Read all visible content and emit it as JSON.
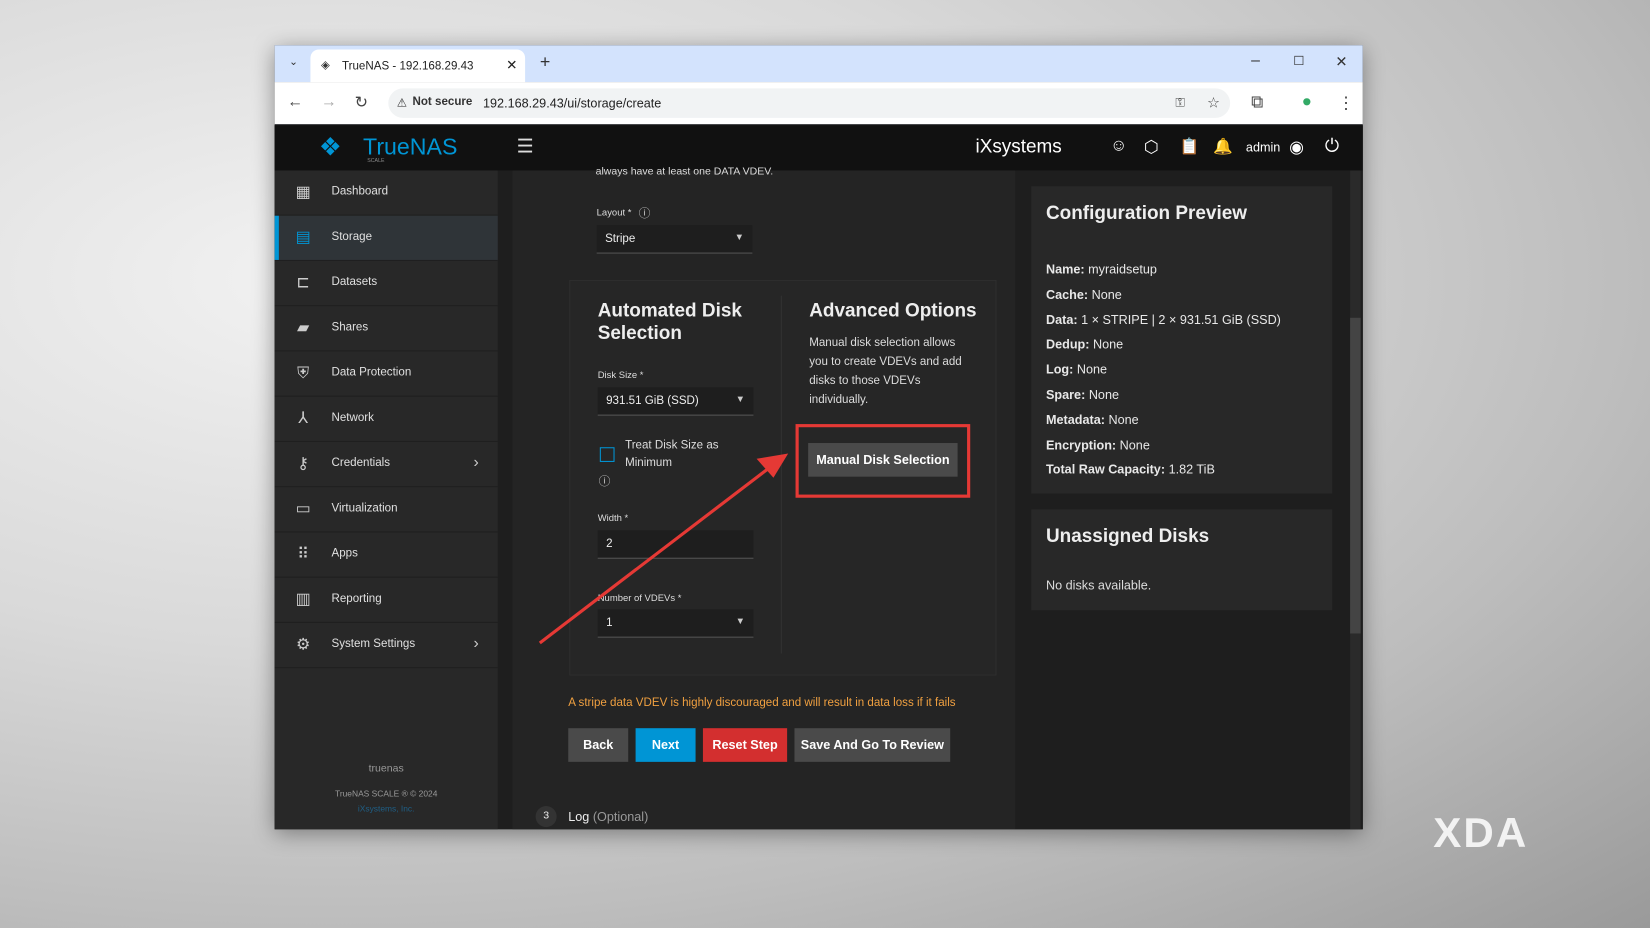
{
  "browser": {
    "tab_title": "TrueNAS - 192.168.29.43",
    "security": "Not secure",
    "url": "192.168.29.43/ui/storage/create"
  },
  "header": {
    "brand": "TrueNAS",
    "brand_sub": "SCALE",
    "partner": "iXsystems",
    "user": "admin"
  },
  "sidebar": {
    "items": [
      {
        "label": "Dashboard"
      },
      {
        "label": "Storage"
      },
      {
        "label": "Datasets"
      },
      {
        "label": "Shares"
      },
      {
        "label": "Data Protection"
      },
      {
        "label": "Network"
      },
      {
        "label": "Credentials"
      },
      {
        "label": "Virtualization"
      },
      {
        "label": "Apps"
      },
      {
        "label": "Reporting"
      },
      {
        "label": "System Settings"
      }
    ],
    "hostname": "truenas",
    "copyright": "TrueNAS SCALE ® © 2024",
    "company": "iXsystems, Inc."
  },
  "form": {
    "top_note": "always have at least one DATA VDEV.",
    "layout_label": "Layout *",
    "layout_value": "Stripe",
    "auto_title": "Automated Disk Selection",
    "disk_size_label": "Disk Size *",
    "disk_size_value": "931.51 GiB (SSD)",
    "treat_min_label": "Treat Disk Size as Minimum",
    "width_label": "Width *",
    "width_value": "2",
    "vdevs_label": "Number of VDEVs *",
    "vdevs_value": "1",
    "adv_title": "Advanced Options",
    "adv_desc": "Manual disk selection allows you to create VDEVs and add disks to those VDEVs individually.",
    "manual_btn": "Manual Disk Selection",
    "warning": "A stripe data VDEV is highly discouraged and will result in data loss if it fails",
    "back": "Back",
    "next": "Next",
    "reset": "Reset Step",
    "save_review": "Save And Go To Review",
    "step_num": "3",
    "step_label": "Log",
    "step_optional": "(Optional)"
  },
  "preview": {
    "title": "Configuration Preview",
    "rows": [
      {
        "k": "Name:",
        "v": "myraidsetup"
      },
      {
        "k": "Cache:",
        "v": "None"
      },
      {
        "k": "Data:",
        "v": "1 × STRIPE | 2 × 931.51 GiB (SSD)"
      },
      {
        "k": "Dedup:",
        "v": "None"
      },
      {
        "k": "Log:",
        "v": "None"
      },
      {
        "k": "Spare:",
        "v": "None"
      },
      {
        "k": "Metadata:",
        "v": "None"
      },
      {
        "k": "Encryption:",
        "v": "None"
      },
      {
        "k": "Total Raw Capacity:",
        "v": "1.82 TiB"
      }
    ]
  },
  "unassigned": {
    "title": "Unassigned Disks",
    "empty": "No disks available."
  },
  "watermark": "XDA",
  "colors": {
    "accent": "#0095d5",
    "danger": "#d32f2f",
    "warning": "#f0a040",
    "highlight": "#e53935"
  }
}
